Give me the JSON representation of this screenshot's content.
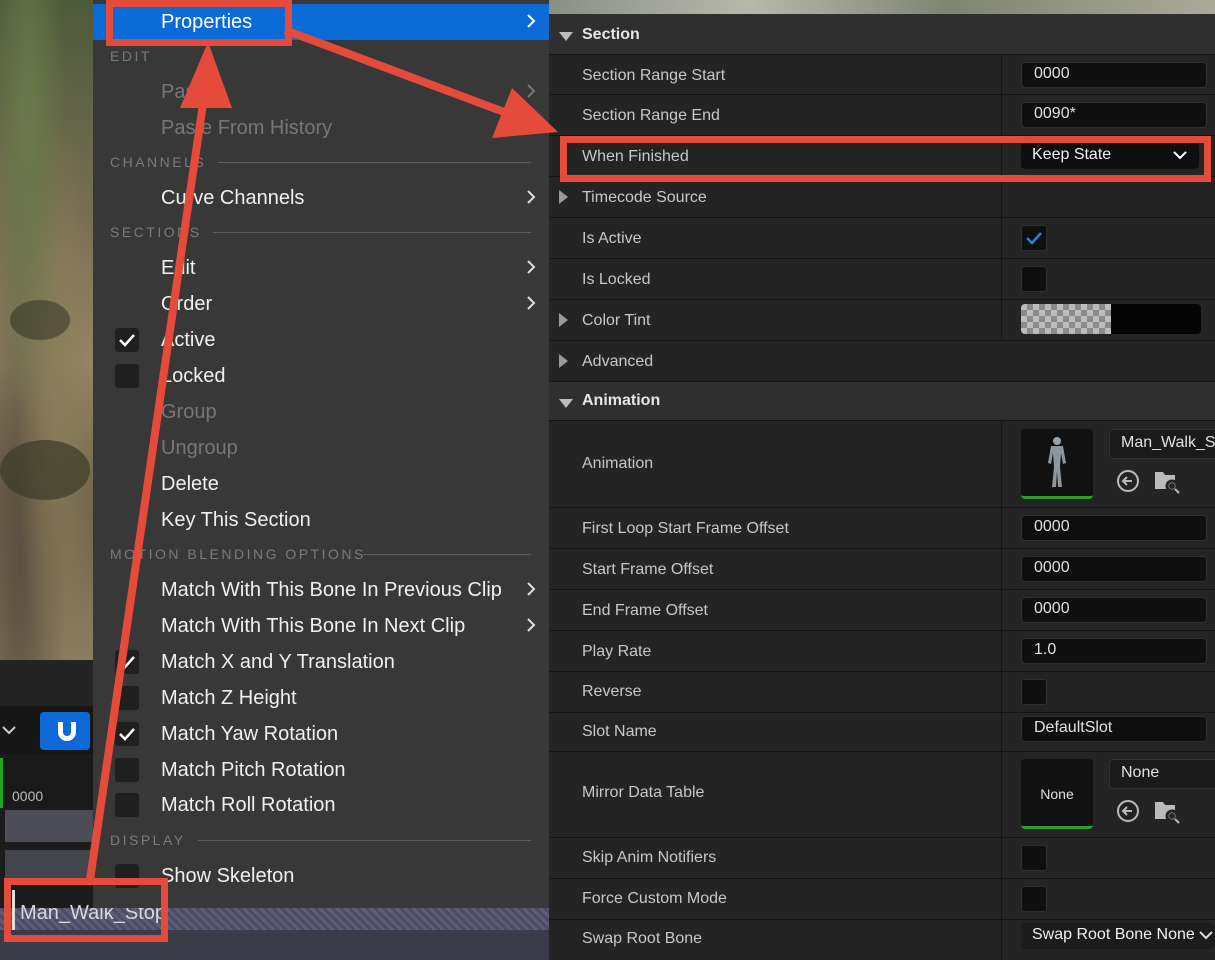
{
  "colors": {
    "accent": "#0a6ad6",
    "annotation": "#e54b3a",
    "menu_bg": "#383838",
    "panel_bg": "#242424"
  },
  "timeline": {
    "time_label": "0000",
    "clip_label": "Man_Walk_Stop"
  },
  "context_menu": {
    "properties": "Properties",
    "sections_headers": {
      "edit": "EDIT",
      "channels": "CHANNELS",
      "sections": "SECTIONS",
      "motion_blending": "MOTION BLENDING OPTIONS",
      "display": "DISPLAY"
    },
    "edit_items": [
      {
        "label": "Paste",
        "disabled": true,
        "submenu": true
      },
      {
        "label": "Paste From History",
        "disabled": true
      }
    ],
    "channels_items": [
      {
        "label": "Curve Channels",
        "submenu": true
      }
    ],
    "sections_items": [
      {
        "label": "Edit",
        "submenu": true
      },
      {
        "label": "Order",
        "submenu": true
      },
      {
        "label": "Active",
        "checked": true
      },
      {
        "label": "Locked",
        "checked": false
      },
      {
        "label": "Group",
        "disabled": true
      },
      {
        "label": "Ungroup",
        "disabled": true
      },
      {
        "label": "Delete"
      },
      {
        "label": "Key This Section"
      }
    ],
    "motion_items": [
      {
        "label": "Match With This Bone In Previous Clip",
        "submenu": true
      },
      {
        "label": "Match With This Bone In Next Clip",
        "submenu": true
      },
      {
        "label": "Match X and Y Translation",
        "checked": true
      },
      {
        "label": "Match Z Height",
        "checked": false
      },
      {
        "label": "Match Yaw Rotation",
        "checked": true
      },
      {
        "label": "Match Pitch Rotation",
        "checked": false
      },
      {
        "label": "Match Roll Rotation",
        "checked": false
      }
    ],
    "display_items": [
      {
        "label": "Show Skeleton",
        "checked": false
      }
    ]
  },
  "details": {
    "section": {
      "header": "Section",
      "range_start_label": "Section Range Start",
      "range_start_value": "0000",
      "range_end_label": "Section Range End",
      "range_end_value": "0090*",
      "when_finished_label": "When Finished",
      "when_finished_value": "Keep State",
      "timecode_label": "Timecode Source",
      "is_active_label": "Is Active",
      "is_active": true,
      "is_locked_label": "Is Locked",
      "is_locked": false,
      "color_tint_label": "Color Tint",
      "advanced_label": "Advanced"
    },
    "animation": {
      "header": "Animation",
      "animation_label": "Animation",
      "animation_asset": "Man_Walk_Stop",
      "first_loop_label": "First Loop Start Frame Offset",
      "first_loop_value": "0000",
      "start_offset_label": "Start Frame Offset",
      "start_offset_value": "0000",
      "end_offset_label": "End Frame Offset",
      "end_offset_value": "0000",
      "play_rate_label": "Play Rate",
      "play_rate_value": "1.0",
      "reverse_label": "Reverse",
      "reverse": false,
      "slot_label": "Slot Name",
      "slot_value": "DefaultSlot",
      "mirror_label": "Mirror Data Table",
      "mirror_thumb": "None",
      "mirror_value": "None",
      "skip_notifiers_label": "Skip Anim Notifiers",
      "skip_notifiers": false,
      "force_custom_label": "Force Custom Mode",
      "force_custom": false,
      "swap_root_label": "Swap Root Bone",
      "swap_root_value": "Swap Root Bone None"
    }
  }
}
